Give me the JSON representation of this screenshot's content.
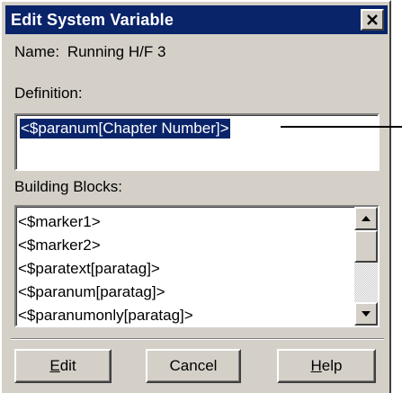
{
  "window": {
    "title": "Edit System Variable",
    "close_icon": "close-icon"
  },
  "name_row": {
    "label": "Name:",
    "value": "Running H/F 3"
  },
  "definition": {
    "label": "Definition:",
    "value": "<$paranum[Chapter Number]>"
  },
  "building_blocks": {
    "label": "Building Blocks:",
    "items": [
      "<$marker1>",
      "<$marker2>",
      "<$paratext[paratag]>",
      "<$paranum[paratag]>",
      "<$paranumonly[paratag]>"
    ]
  },
  "buttons": {
    "edit": {
      "mnemonic": "E",
      "rest": "dit"
    },
    "cancel": "Cancel",
    "help": {
      "mnemonic": "H",
      "rest": "elp"
    }
  },
  "colors": {
    "title_bar": "#0a246a",
    "dialog_face": "#d4d0c8",
    "selection": "#0a246a"
  }
}
